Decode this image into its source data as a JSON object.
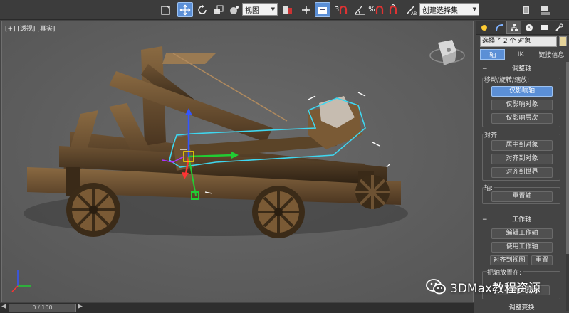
{
  "toolbar": {
    "view_select": "视图",
    "selection_set": "创建选择集"
  },
  "viewport": {
    "label": "[+] [透视] [真实]"
  },
  "timeline": {
    "frame": "0 / 100"
  },
  "panel": {
    "selection_name": "选择了 2 个 对象",
    "selection_color": "#e6d49a",
    "subtabs": [
      "轴",
      "IK",
      "链接信息"
    ],
    "adjust_pivot": {
      "title": "调整轴",
      "move_group": "移动/旋转/缩放:",
      "affect_pivot_only": "仅影响轴",
      "affect_object_only": "仅影响对象",
      "affect_hierarchy_only": "仅影响层次",
      "align_group": "对齐:",
      "center_to_object": "居中到对象",
      "align_to_object": "对齐到对象",
      "align_to_world": "对齐到世界",
      "pivot_group": "轴:",
      "reset_pivot": "重置轴"
    },
    "working_pivot": {
      "title": "工作轴",
      "edit_working_pivot": "编辑工作轴",
      "use_working_pivot": "使用工作轴",
      "align_to_view": "对齐到视图",
      "reset": "重置",
      "place_pivot_group": "把轴放置在:",
      "align_to_view_2": "对齐到视图"
    },
    "next_rollout": "调整变换"
  },
  "watermark": {
    "text": "3DMax教程资源"
  },
  "colors": {
    "accent": "#5b8fd6",
    "viewport_bg": "#5a5a5a",
    "selection_highlight": "#3fd7f0"
  }
}
